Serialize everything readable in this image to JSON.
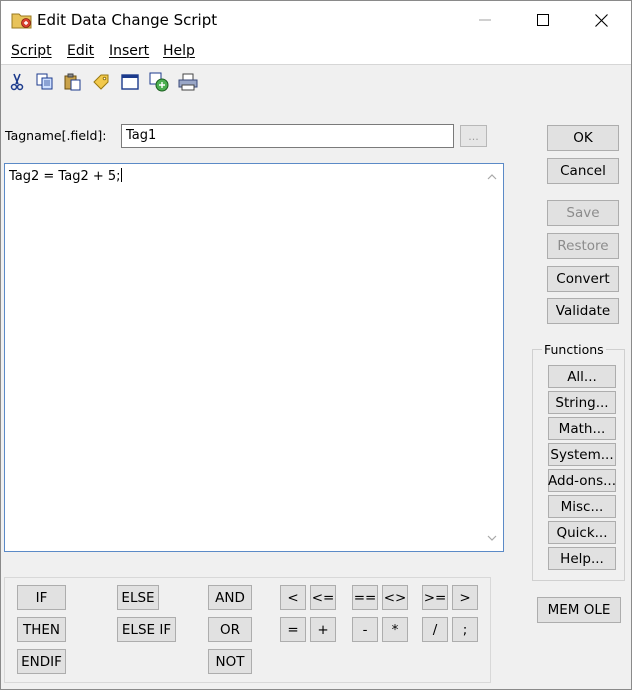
{
  "window": {
    "title": "Edit Data Change Script",
    "minimize": "—",
    "maximize": "☐",
    "close": "✕"
  },
  "menu": [
    "Script",
    "Edit",
    "Insert",
    "Help"
  ],
  "toolbar": [
    "cut-icon",
    "copy-icon",
    "paste-icon",
    "find-tag-icon",
    "window-icon",
    "convert-icon",
    "print-icon"
  ],
  "tagname": {
    "label": "Tagname[.field]:",
    "value": "Tag1",
    "browse": "..."
  },
  "editor": {
    "text": "Tag2 = Tag2 + 5;"
  },
  "actions": {
    "ok": "OK",
    "cancel": "Cancel",
    "save": "Save",
    "restore": "Restore",
    "convert": "Convert",
    "validate": "Validate"
  },
  "functions": {
    "title": "Functions",
    "all": "All...",
    "string": "String...",
    "math": "Math...",
    "system": "System...",
    "addons": "Add-ons...",
    "misc": "Misc...",
    "quick": "Quick...",
    "help": "Help..."
  },
  "mem_ole": "MEM OLE",
  "keywords": {
    "if": "IF",
    "then": "THEN",
    "endif": "ENDIF",
    "else": "ELSE",
    "else_if": "ELSE IF",
    "and": "AND",
    "or": "OR",
    "not": "NOT"
  },
  "operators": {
    "lt": "<",
    "le": "<=",
    "eq": "==",
    "ne": "<>",
    "ge": ">=",
    "gt": ">",
    "assign": "=",
    "plus": "+",
    "minus": "-",
    "times": "*",
    "divide": "/",
    "semicolon": ";"
  }
}
